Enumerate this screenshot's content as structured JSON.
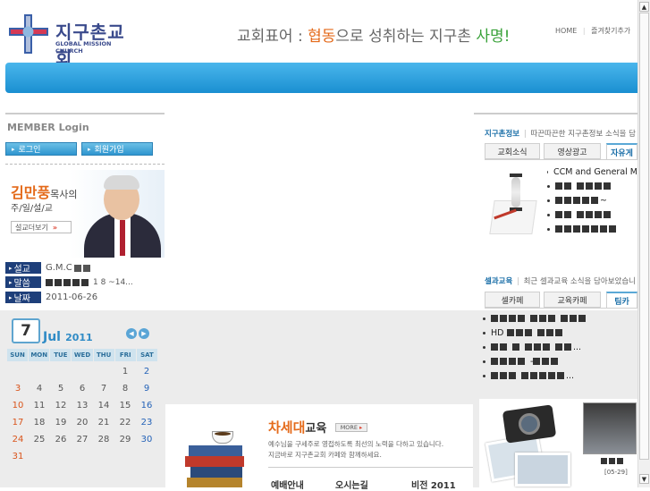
{
  "header": {
    "logo_korean": "지구촌교회",
    "logo_english": "GLOBAL MISSION CHURCH",
    "slogan_prefix": "교회표어 : ",
    "slogan_word1": "협동",
    "slogan_middle": "으로 성취하는 지구촌 ",
    "slogan_word2": "사명!",
    "top_links": [
      "HOME",
      "즐겨찾기추가"
    ]
  },
  "member": {
    "title": "MEMBER Login",
    "login_button": "로그인",
    "join_button": "회원가입"
  },
  "sermon": {
    "pastor_name": "김만풍",
    "pastor_suffix": "목사의",
    "subtitle": "주/일/설/교",
    "more_button": "설교더보기",
    "rows": [
      {
        "label": "설교",
        "value": "G.M.C"
      },
      {
        "label": "말씀",
        "value": "1 8 ~14..."
      },
      {
        "label": "날짜",
        "value": "2011-06-26"
      }
    ]
  },
  "calendar": {
    "day": "7",
    "month": "Jul",
    "year": "2011",
    "weekdays": [
      "SUN",
      "MON",
      "TUE",
      "WED",
      "THU",
      "FRI",
      "SAT"
    ],
    "weeks": [
      [
        "",
        "",
        "",
        "",
        "",
        "1",
        "2"
      ],
      [
        "3",
        "4",
        "5",
        "6",
        "7",
        "8",
        "9"
      ],
      [
        "10",
        "11",
        "12",
        "13",
        "14",
        "15",
        "16"
      ],
      [
        "17",
        "18",
        "19",
        "20",
        "21",
        "22",
        "23"
      ],
      [
        "24",
        "25",
        "26",
        "27",
        "28",
        "29",
        "30"
      ],
      [
        "31",
        "",
        "",
        "",
        "",
        "",
        ""
      ]
    ]
  },
  "next_gen": {
    "title_highlight": "차세대",
    "title_rest": "교육",
    "more": "MORE",
    "desc_line1": "예수님을 구세주로 영접하도록 최선의 노력을 다하고 있습니다.",
    "desc_line2": "지금바로 지구촌교회 카페와 함께하세요.",
    "bottom_links": [
      "예배안내",
      "오시는길",
      "비전 2011"
    ]
  },
  "news": {
    "section_title": "지구촌정보",
    "section_desc": "따끈따끈한 지구촌정보 소식을 담",
    "tabs": [
      "교회소식",
      "영상광고",
      "자유게"
    ],
    "items": [
      "CCM and General M",
      "",
      "~",
      "",
      ""
    ]
  },
  "education": {
    "section_title": "셀과교육",
    "section_desc": "최근 셀과교육 소식을 담아보았습니",
    "tabs": [
      "셀카페",
      "교육카페",
      "팀카"
    ],
    "items": [
      "",
      "HD",
      "...",
      "-",
      "..."
    ]
  },
  "photo": {
    "caption": "[05-29]"
  }
}
